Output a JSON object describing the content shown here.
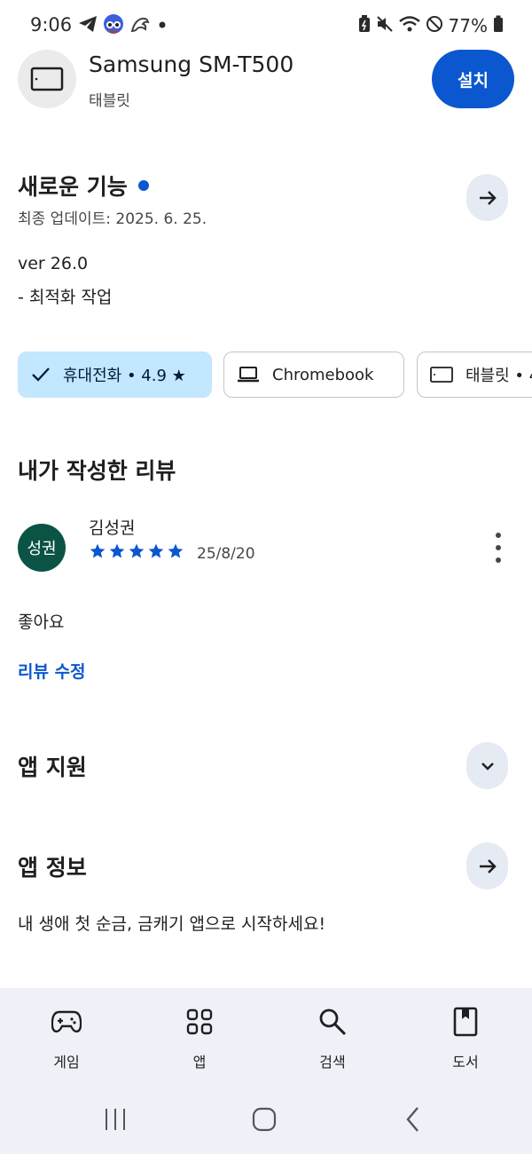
{
  "status_bar": {
    "time": "9:06",
    "battery_percent": "77%",
    "left_icons": [
      "telegram-icon",
      "avatar-sticker-icon",
      "dragon-icon",
      "dot-icon"
    ],
    "right_icons": [
      "battery-saver-icon",
      "mute-icon",
      "wifi-icon",
      "do-not-disturb-icon",
      "battery-icon"
    ]
  },
  "device": {
    "name": "Samsung SM-T500",
    "type": "태블릿",
    "install_label": "설치",
    "icon": "tablet-icon"
  },
  "whats_new": {
    "title": "새로운 기능",
    "last_updated": "최종 업데이트: 2025. 6. 25.",
    "version": "ver 26.0",
    "notes": "- 최적화 작업"
  },
  "device_chips": [
    {
      "label": "휴대전화 • 4.9 ★",
      "icon": "check-icon",
      "selected": true
    },
    {
      "label": "Chromebook",
      "icon": "laptop-icon",
      "selected": false
    },
    {
      "label": "태블릿 • 4",
      "icon": "tablet-icon",
      "selected": false
    }
  ],
  "my_review": {
    "section_title": "내가 작성한 리뷰",
    "avatar_text": "성권",
    "reviewer": "김성권",
    "rating": 5,
    "date": "25/8/20",
    "text": "좋아요",
    "edit_label": "리뷰 수정"
  },
  "app_support": {
    "title": "앱 지원"
  },
  "app_info": {
    "title": "앱 정보",
    "description": "내 생애 첫 순금, 금캐기 앱으로 시작하세요!"
  },
  "bottom_nav": [
    {
      "label": "게임",
      "icon": "gamepad-icon"
    },
    {
      "label": "앱",
      "icon": "apps-grid-icon"
    },
    {
      "label": "검색",
      "icon": "search-icon"
    },
    {
      "label": "도서",
      "icon": "book-icon"
    }
  ],
  "colors": {
    "accent": "#0b57d0",
    "chip_selected": "#c2e7ff",
    "nav_background": "#eef2f8",
    "avatar_bg": "#0b5345"
  }
}
